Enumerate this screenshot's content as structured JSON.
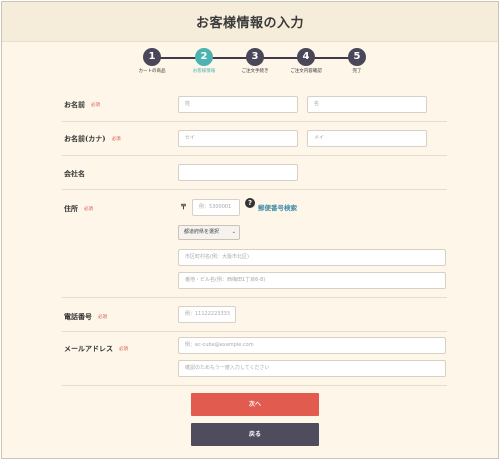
{
  "page": {
    "title": "お客様情報の入力"
  },
  "steps": [
    {
      "number": "1",
      "label": "カートの商品"
    },
    {
      "number": "2",
      "label": "お客様情報"
    },
    {
      "number": "3",
      "label": "ご注文手続き"
    },
    {
      "number": "4",
      "label": "ご注文内容確認"
    },
    {
      "number": "5",
      "label": "完了"
    }
  ],
  "required_badge": "必須",
  "form": {
    "name": {
      "label": "お名前",
      "last_placeholder": "姓",
      "first_placeholder": "名"
    },
    "kana": {
      "label": "お名前(カナ)",
      "last_placeholder": "セイ",
      "first_placeholder": "メイ"
    },
    "company": {
      "label": "会社名",
      "placeholder": ""
    },
    "address": {
      "label": "住所",
      "zip_mark": "〒",
      "zip_placeholder": "例：5300001",
      "help": "?",
      "zip_lookup_link": "郵便番号検索",
      "prefecture_selected": "都道府県を選択",
      "city_placeholder": "市区町村名(例：大阪市北区)",
      "street_placeholder": "番地・ビル名(例：西梅田1丁目6-8)"
    },
    "phone": {
      "label": "電話番号",
      "placeholder": "例：11122223333"
    },
    "email": {
      "label": "メールアドレス",
      "placeholder": "例：ec-cube@example.com",
      "confirm_placeholder": "確認のためもう一度入力してください"
    }
  },
  "buttons": {
    "next": "次へ",
    "back": "戻る"
  }
}
